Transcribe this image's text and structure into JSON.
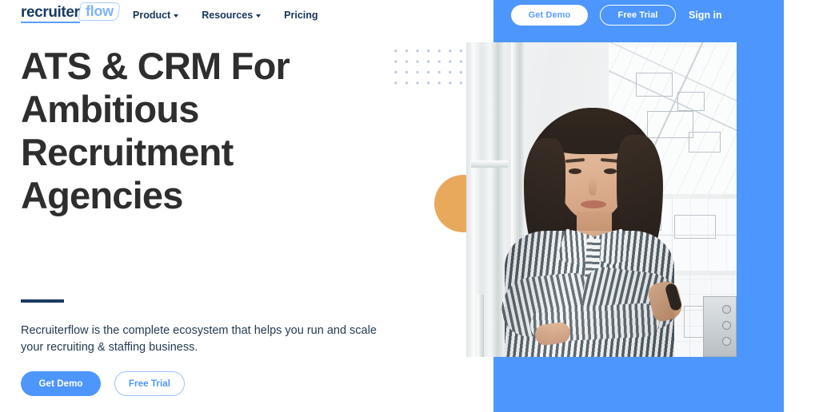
{
  "brand": {
    "logo_word": "recruiter",
    "logo_accent": "flow",
    "accent_color": "#4d96fd",
    "navy_color": "#16355c",
    "orange_color": "#e9a95c"
  },
  "nav": {
    "items": [
      {
        "label": "Product",
        "has_dropdown": true,
        "icon": "chevron-down-icon"
      },
      {
        "label": "Resources",
        "has_dropdown": true,
        "icon": "chevron-down-icon"
      },
      {
        "label": "Pricing",
        "has_dropdown": false,
        "icon": ""
      }
    ]
  },
  "top_actions": {
    "get_demo_label": "Get Demo",
    "free_trial_label": "Free Trial",
    "sign_in_label": "Sign in"
  },
  "hero": {
    "heading": "ATS & CRM For Ambitious Recruitment Agencies",
    "subheading": "Recruiterflow is the complete ecosystem that helps you run and scale your recruiting & staffing business.",
    "cta_primary": "Get Demo",
    "cta_secondary": "Free Trial",
    "photo_alt": "Smiling woman with dark wavy hair in a striped shirt standing with arms crossed beside a window, architectural blueprints on the wall behind her"
  }
}
